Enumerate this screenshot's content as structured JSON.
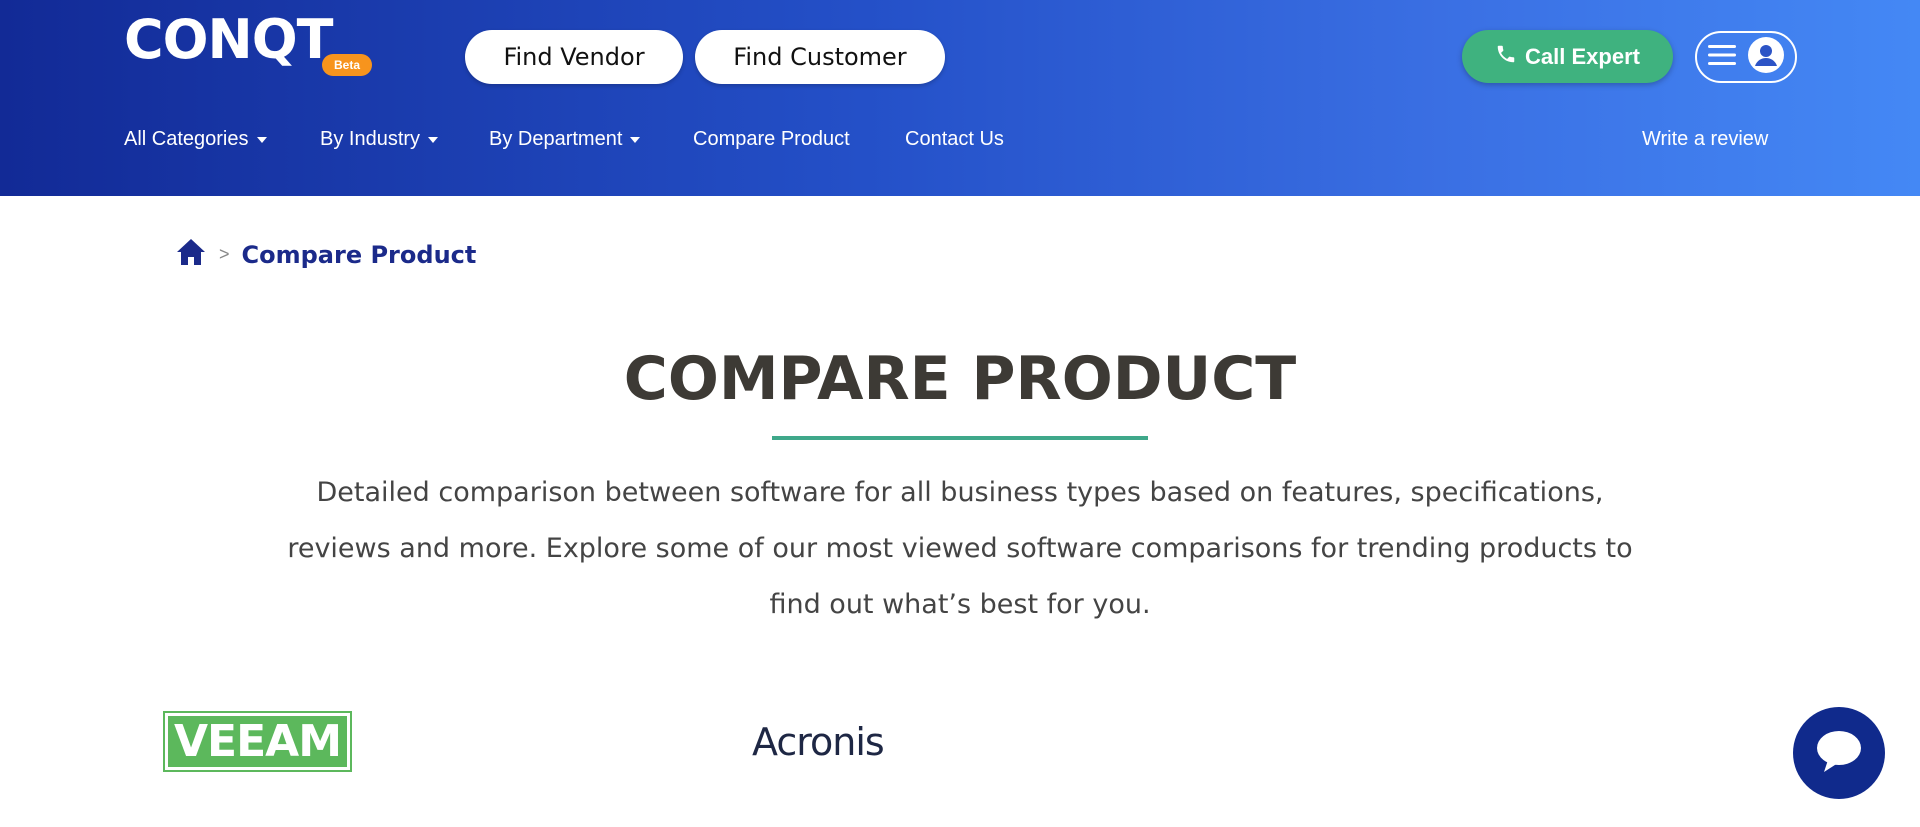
{
  "header": {
    "logo_text": "CONQT",
    "beta_label": "Beta",
    "find_vendor_label": "Find Vendor",
    "find_customer_label": "Find Customer",
    "call_expert_label": "Call Expert",
    "nav": {
      "all_categories": "All Categories",
      "by_industry": "By Industry",
      "by_department": "By Department",
      "compare_product": "Compare Product",
      "contact_us": "Contact Us",
      "write_review": "Write a review"
    }
  },
  "breadcrumb": {
    "separator": ">",
    "current": "Compare Product"
  },
  "main": {
    "title": "COMPARE PRODUCT",
    "description": "Detailed comparison between software for all business types based on features, specifications, reviews and more. Explore some of our most viewed software comparisons for trending products to find out what’s best for you."
  },
  "products": {
    "left_logo_text": "VEEAM",
    "right_logo_text": "Acronis"
  },
  "colors": {
    "header_start": "#122a96",
    "header_end": "#4488f5",
    "call_expert": "#3fb27f",
    "beta": "#f7941d",
    "underline": "#3fa88a",
    "breadcrumb": "#1b2a8a",
    "chat": "#102a8c"
  },
  "icons": {
    "home": "home-icon",
    "phone": "phone-icon",
    "menu": "hamburger-icon",
    "user": "user-icon",
    "chat": "chat-bubble-icon"
  }
}
